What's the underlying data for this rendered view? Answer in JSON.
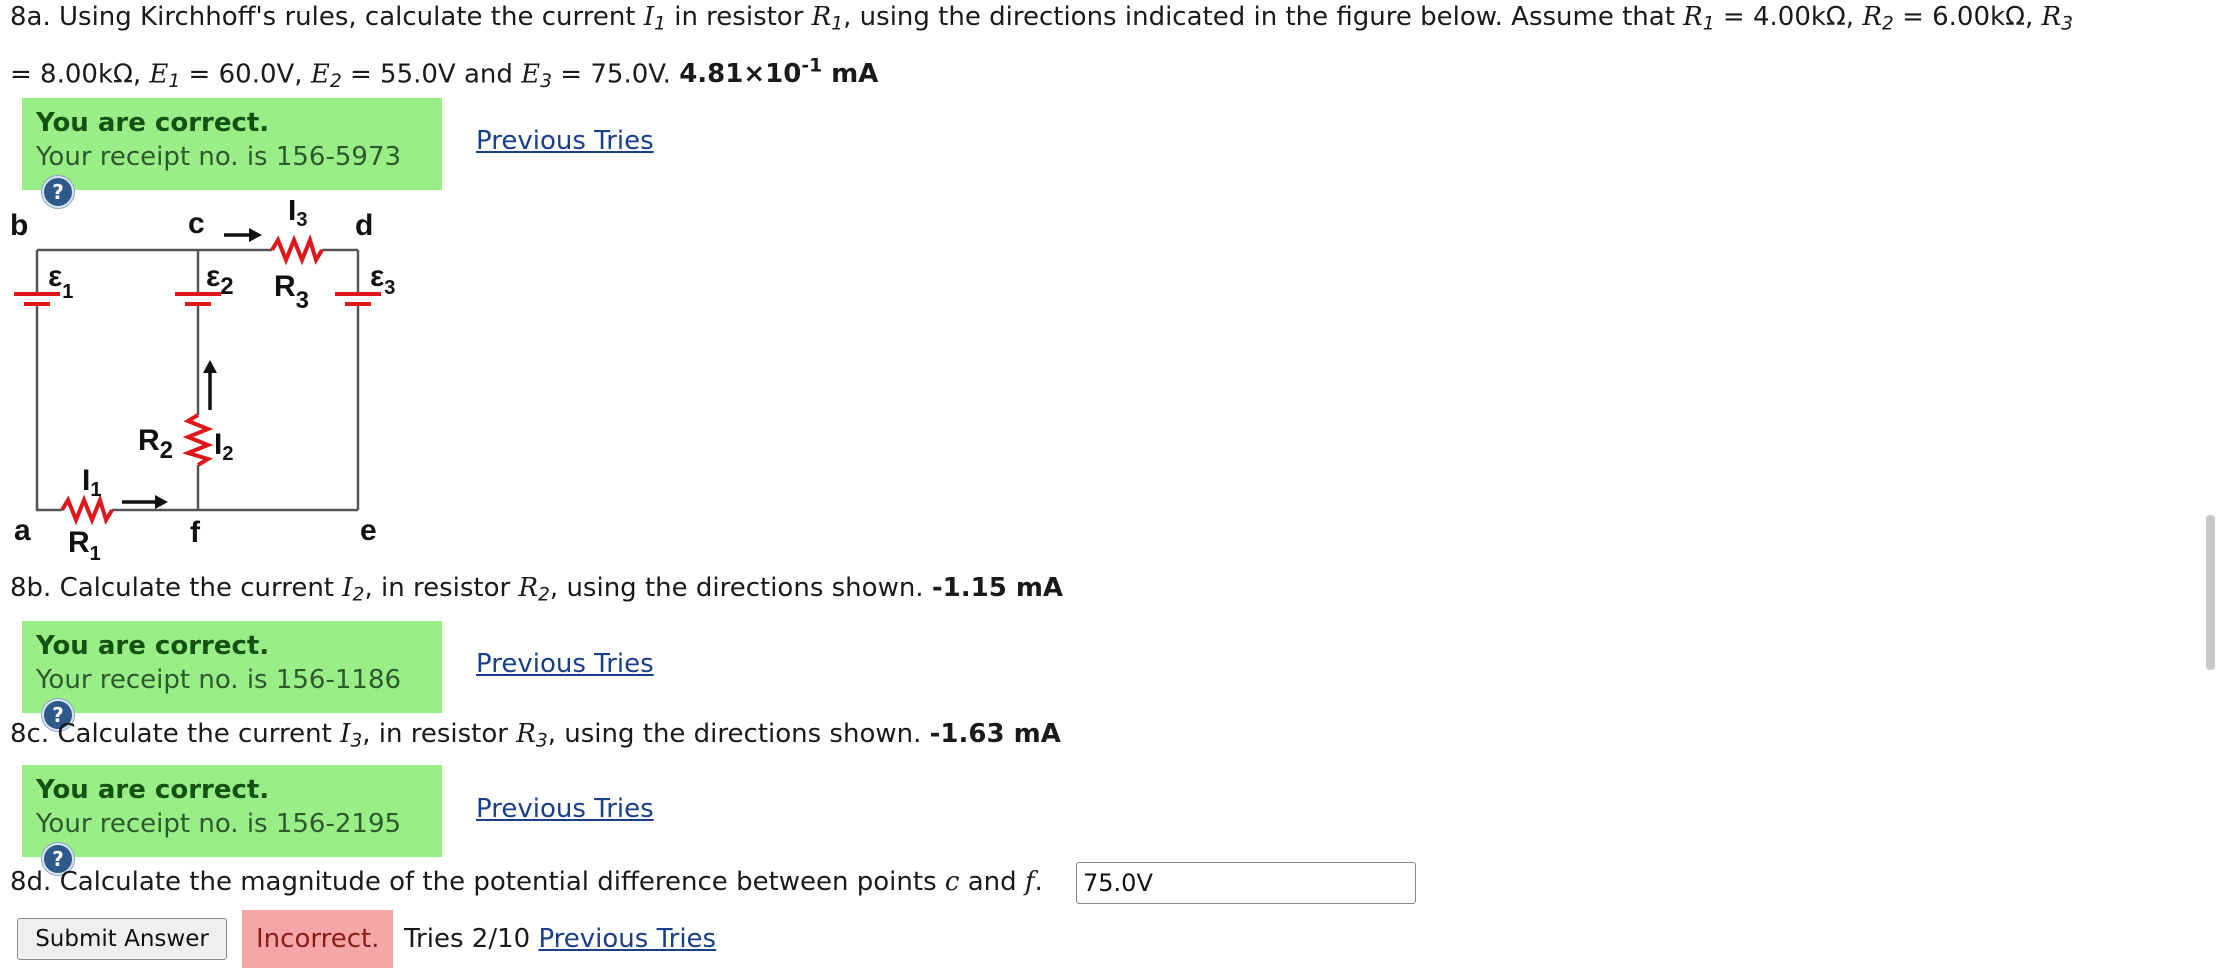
{
  "q8a": {
    "prefix": "8a. Using Kirchhoff's rules, calculate the current ",
    "I1": "I",
    "I1_sub": "1",
    "mid1": " in resistor ",
    "R1": "R",
    "R1_sub": "1",
    "mid2": ", using the directions indicated in the figure below. Assume that ",
    "R1b": "R",
    "R1b_sub": "1",
    "R1_val": " = 4.00kΩ, ",
    "R2": "R",
    "R2_sub": "2",
    "R2_val": " = 6.00kΩ, ",
    "R3": "R",
    "R3_sub": "3",
    "line2_start": "= 8.00kΩ, ",
    "E1": "E",
    "E1_sub": "1",
    "E1_val": " = 60.0V, ",
    "E2": "E",
    "E2_sub": "2",
    "E2_val": " = 55.0V and ",
    "E3": "E",
    "E3_sub": "3",
    "E3_val": " = 75.0V. ",
    "answer_base": "4.81×10",
    "answer_exp": "-1",
    "answer_unit": " mA"
  },
  "feedback_a": {
    "title": "You are correct.",
    "receipt": "Your receipt no. is 156-5973",
    "help": "?",
    "link": "Previous Tries"
  },
  "circuit": {
    "labels": {
      "b": "b",
      "c": "c",
      "d": "d",
      "a": "a",
      "f": "f",
      "e": "e",
      "I3": "I",
      "I3_sub": "3",
      "I2": "I",
      "I2_sub": "2",
      "I1": "I",
      "I1_sub": "1",
      "E1": "ε",
      "E1_sub": "1",
      "E2": "ε",
      "E2_sub": "2",
      "E3": "ε",
      "E3_sub": "3",
      "R1": "R",
      "R1_sub": "1",
      "R2": "R",
      "R2_sub": "2",
      "R3": "R",
      "R3_sub": "3"
    },
    "resistor_color": "#e0161b",
    "battery_color": "#e0161b"
  },
  "q8b": {
    "prefix": "8b. Calculate the current ",
    "I": "I",
    "I_sub": "2",
    "mid": ", in resistor ",
    "R": "R",
    "R_sub": "2",
    "suffix": ", using the directions shown. ",
    "answer": "-1.15 mA"
  },
  "feedback_b": {
    "title": "You are correct.",
    "receipt": "Your receipt no. is 156-1186",
    "help": "?",
    "link": "Previous Tries"
  },
  "q8c": {
    "prefix": "8c. Calculate the current ",
    "I": "I",
    "I_sub": "3",
    "mid": ", in resistor ",
    "R": "R",
    "R_sub": "3",
    "suffix": ", using the directions shown. ",
    "answer": "-1.63 mA"
  },
  "feedback_c": {
    "title": "You are correct.",
    "receipt": "Your receipt no. is 156-2195",
    "help": "?",
    "link": "Previous Tries"
  },
  "q8d": {
    "prefix": "8d. Calculate the magnitude of the potential difference between points ",
    "c": "c",
    "and": " and ",
    "f": "f",
    "period": ".",
    "input_value": "75.0V"
  },
  "submit": {
    "button_label": "Submit Answer",
    "status": "Incorrect.",
    "tries": "Tries 2/10",
    "link": "Previous Tries"
  },
  "colors": {
    "correct_bg": "#99ee88",
    "incorrect_bg": "#f5a6a6",
    "link": "#1a3f8a"
  }
}
